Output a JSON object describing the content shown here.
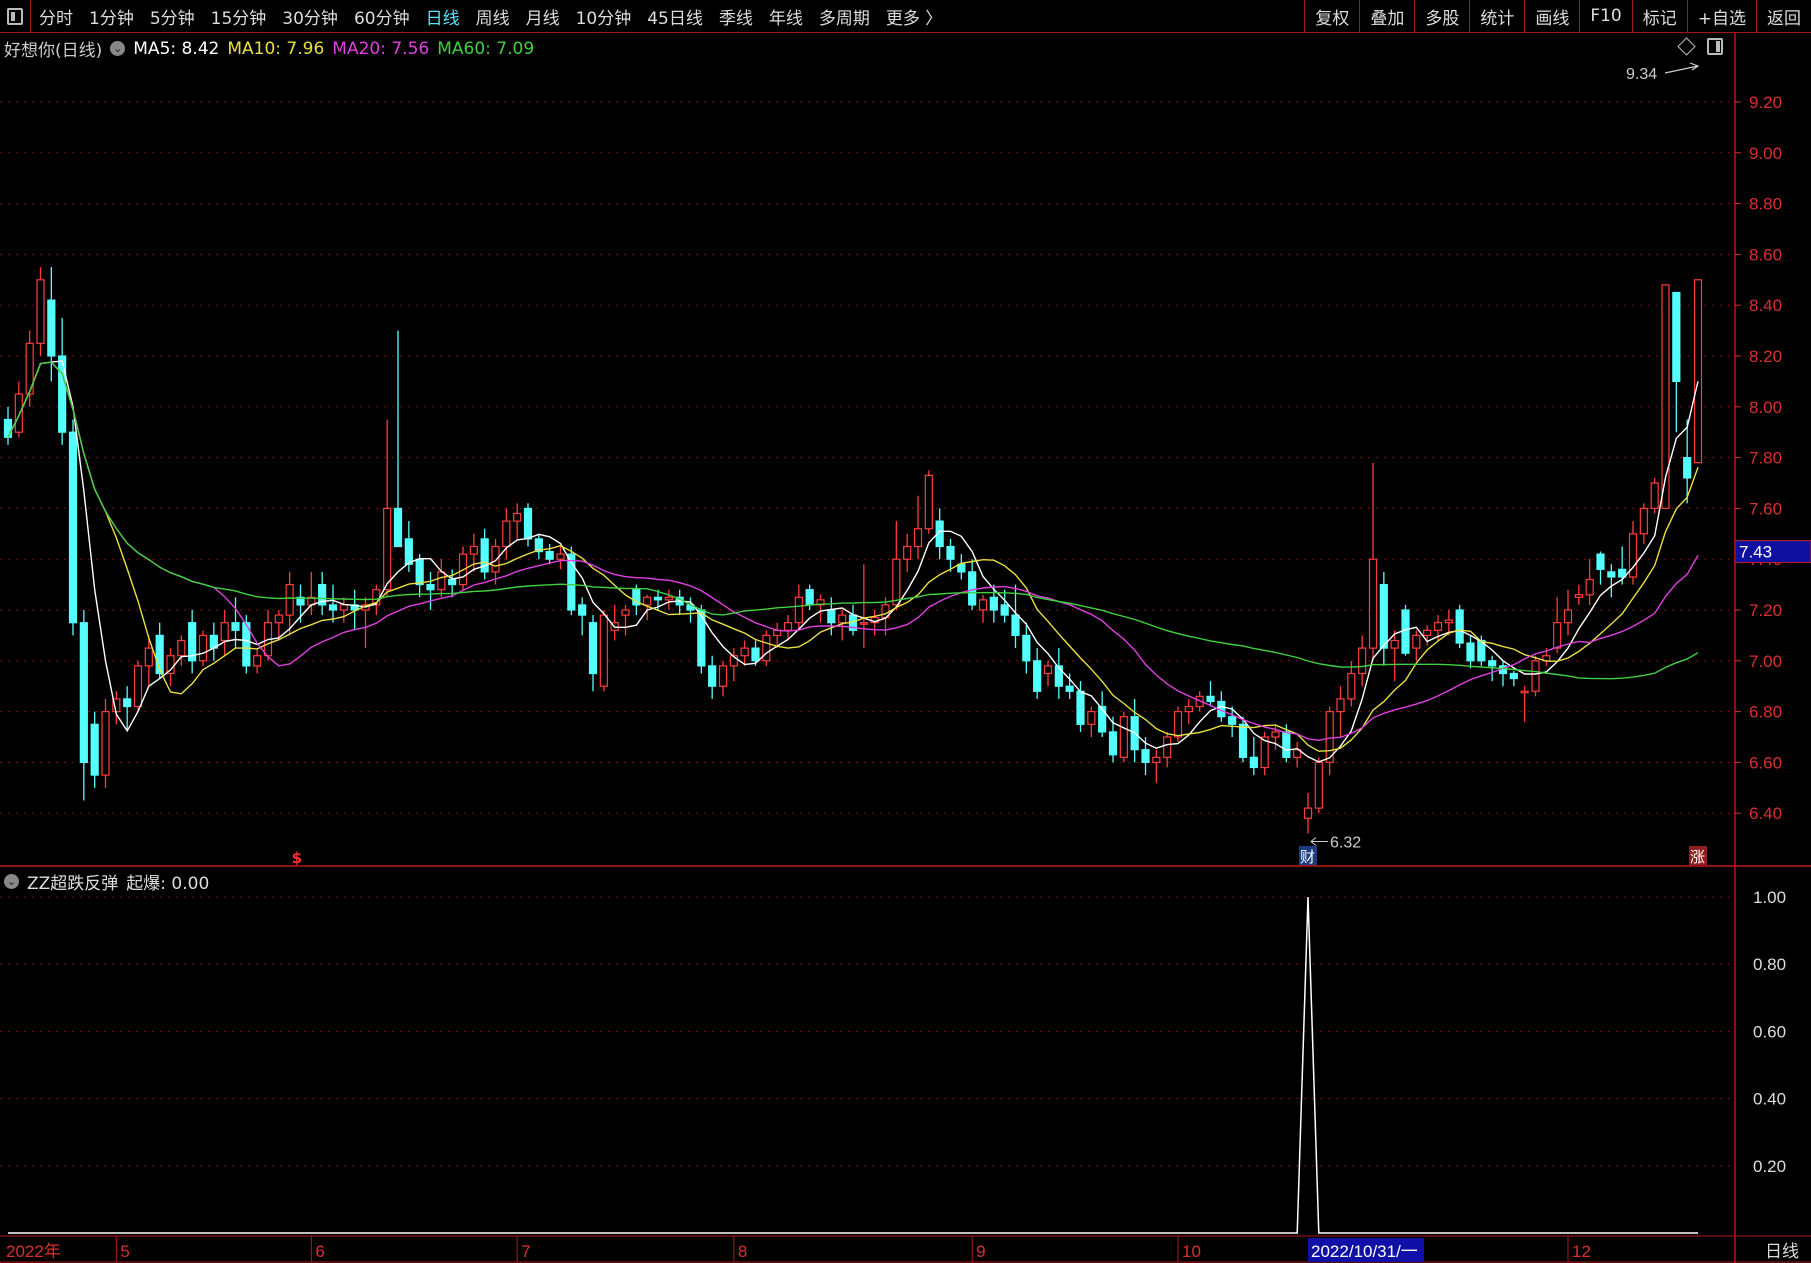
{
  "toolbar": {
    "periods": [
      "分时",
      "1分钟",
      "5分钟",
      "15分钟",
      "30分钟",
      "60分钟",
      "日线",
      "周线",
      "月线",
      "10分钟",
      "45日线",
      "季线",
      "年线",
      "多周期",
      "更多 〉"
    ],
    "active_period": "日线",
    "right_buttons": [
      "复权",
      "叠加",
      "多股",
      "统计",
      "画线",
      "F10",
      "标记",
      "+自选",
      "返回"
    ]
  },
  "legend": {
    "title": "好想你(日线)",
    "ma5": "MA5: 8.42",
    "ma10": "MA10: 7.96",
    "ma20": "MA20: 7.56",
    "ma60": "MA60: 7.09"
  },
  "indicator": {
    "name": "ZZ超跌反弹",
    "value_label": "起爆: 0.00",
    "axis_labels": [
      "1.00",
      "0.80",
      "0.60",
      "0.40",
      "0.20"
    ]
  },
  "annotations": {
    "high_label": "9.34",
    "low_label": "6.32",
    "current_price": "7.43",
    "marker_cai": "财",
    "marker_zhang": "涨",
    "marker_dollar": "$"
  },
  "axis": {
    "price_labels": [
      "9.20",
      "9.00",
      "8.80",
      "8.60",
      "8.40",
      "8.20",
      "8.00",
      "7.80",
      "7.60",
      "7.40",
      "7.20",
      "7.00",
      "6.80",
      "6.60",
      "6.40"
    ],
    "period_label": "日线"
  },
  "colors": {
    "up": "#ff3c3c",
    "down": "#54ffff",
    "ma5": "#ffffff",
    "ma10": "#e8e040",
    "ma20": "#e040e0",
    "ma60": "#40d040",
    "grid": "#7a1010",
    "axis": "#d83030"
  },
  "chart_data": {
    "type": "candlestick",
    "price_range": [
      6.24,
      9.34
    ],
    "ohlc": [
      [
        7.95,
        8.0,
        7.85,
        7.88
      ],
      [
        7.9,
        8.1,
        7.88,
        8.05
      ],
      [
        8.05,
        8.3,
        8.0,
        8.25
      ],
      [
        8.25,
        8.55,
        8.2,
        8.5
      ],
      [
        8.42,
        8.55,
        8.1,
        8.2
      ],
      [
        8.2,
        8.35,
        7.85,
        7.9
      ],
      [
        7.9,
        7.95,
        7.1,
        7.15
      ],
      [
        7.15,
        7.2,
        6.45,
        6.6
      ],
      [
        6.75,
        6.8,
        6.5,
        6.55
      ],
      [
        6.55,
        6.85,
        6.5,
        6.8
      ],
      [
        6.8,
        6.88,
        6.75,
        6.85
      ],
      [
        6.85,
        6.9,
        6.73,
        6.82
      ],
      [
        6.82,
        7.0,
        6.8,
        6.98
      ],
      [
        6.98,
        7.1,
        6.9,
        7.05
      ],
      [
        7.1,
        7.15,
        6.93,
        6.95
      ],
      [
        6.95,
        7.05,
        6.9,
        7.02
      ],
      [
        7.02,
        7.1,
        6.98,
        7.08
      ],
      [
        7.15,
        7.2,
        6.95,
        7.0
      ],
      [
        7.0,
        7.12,
        6.98,
        7.1
      ],
      [
        7.1,
        7.15,
        7.0,
        7.05
      ],
      [
        7.08,
        7.2,
        7.02,
        7.15
      ],
      [
        7.15,
        7.25,
        7.05,
        7.12
      ],
      [
        7.15,
        7.18,
        6.95,
        6.98
      ],
      [
        6.98,
        7.05,
        6.95,
        7.02
      ],
      [
        7.02,
        7.2,
        7.0,
        7.15
      ],
      [
        7.15,
        7.2,
        7.08,
        7.18
      ],
      [
        7.18,
        7.35,
        7.1,
        7.3
      ],
      [
        7.25,
        7.3,
        7.15,
        7.22
      ],
      [
        7.22,
        7.35,
        7.18,
        7.25
      ],
      [
        7.3,
        7.35,
        7.18,
        7.22
      ],
      [
        7.22,
        7.3,
        7.15,
        7.2
      ],
      [
        7.2,
        7.25,
        7.15,
        7.22
      ],
      [
        7.22,
        7.28,
        7.12,
        7.2
      ],
      [
        7.2,
        7.25,
        7.05,
        7.22
      ],
      [
        7.22,
        7.3,
        7.18,
        7.28
      ],
      [
        7.28,
        7.95,
        7.25,
        7.6
      ],
      [
        7.6,
        8.3,
        7.45,
        7.45
      ],
      [
        7.48,
        7.55,
        7.35,
        7.38
      ],
      [
        7.4,
        7.42,
        7.25,
        7.3
      ],
      [
        7.3,
        7.35,
        7.2,
        7.28
      ],
      [
        7.28,
        7.4,
        7.25,
        7.35
      ],
      [
        7.32,
        7.36,
        7.25,
        7.3
      ],
      [
        7.3,
        7.45,
        7.28,
        7.42
      ],
      [
        7.42,
        7.5,
        7.35,
        7.45
      ],
      [
        7.48,
        7.52,
        7.32,
        7.35
      ],
      [
        7.35,
        7.48,
        7.3,
        7.45
      ],
      [
        7.45,
        7.6,
        7.4,
        7.55
      ],
      [
        7.55,
        7.62,
        7.48,
        7.58
      ],
      [
        7.6,
        7.62,
        7.45,
        7.48
      ],
      [
        7.48,
        7.5,
        7.4,
        7.43
      ],
      [
        7.43,
        7.46,
        7.38,
        7.4
      ],
      [
        7.4,
        7.45,
        7.36,
        7.42
      ],
      [
        7.42,
        7.45,
        7.18,
        7.2
      ],
      [
        7.22,
        7.25,
        7.1,
        7.18
      ],
      [
        7.15,
        7.18,
        6.88,
        6.95
      ],
      [
        6.9,
        7.2,
        6.88,
        7.18
      ],
      [
        7.12,
        7.22,
        7.08,
        7.15
      ],
      [
        7.18,
        7.22,
        7.1,
        7.2
      ],
      [
        7.28,
        7.3,
        7.18,
        7.22
      ],
      [
        7.22,
        7.26,
        7.16,
        7.25
      ],
      [
        7.25,
        7.28,
        7.2,
        7.24
      ],
      [
        7.24,
        7.28,
        7.2,
        7.25
      ],
      [
        7.25,
        7.28,
        7.18,
        7.22
      ],
      [
        7.22,
        7.25,
        7.15,
        7.2
      ],
      [
        7.2,
        7.22,
        6.95,
        6.98
      ],
      [
        6.98,
        7.02,
        6.85,
        6.9
      ],
      [
        6.9,
        7.0,
        6.86,
        6.98
      ],
      [
        6.98,
        7.05,
        6.92,
        7.02
      ],
      [
        7.02,
        7.08,
        6.98,
        7.05
      ],
      [
        7.05,
        7.08,
        6.98,
        7.0
      ],
      [
        7.0,
        7.12,
        6.98,
        7.1
      ],
      [
        7.1,
        7.15,
        7.05,
        7.12
      ],
      [
        7.12,
        7.18,
        7.08,
        7.15
      ],
      [
        7.15,
        7.3,
        7.12,
        7.25
      ],
      [
        7.28,
        7.3,
        7.2,
        7.22
      ],
      [
        7.22,
        7.26,
        7.15,
        7.24
      ],
      [
        7.2,
        7.25,
        7.1,
        7.15
      ],
      [
        7.15,
        7.2,
        7.08,
        7.18
      ],
      [
        7.18,
        7.22,
        7.1,
        7.12
      ],
      [
        7.15,
        7.38,
        7.05,
        7.15
      ],
      [
        7.15,
        7.2,
        7.1,
        7.17
      ],
      [
        7.17,
        7.25,
        7.1,
        7.22
      ],
      [
        7.22,
        7.55,
        7.2,
        7.4
      ],
      [
        7.4,
        7.5,
        7.35,
        7.45
      ],
      [
        7.45,
        7.65,
        7.4,
        7.52
      ],
      [
        7.52,
        7.75,
        7.5,
        7.73
      ],
      [
        7.55,
        7.6,
        7.4,
        7.45
      ],
      [
        7.45,
        7.48,
        7.35,
        7.4
      ],
      [
        7.38,
        7.42,
        7.32,
        7.35
      ],
      [
        7.35,
        7.4,
        7.2,
        7.22
      ],
      [
        7.2,
        7.26,
        7.15,
        7.24
      ],
      [
        7.25,
        7.3,
        7.15,
        7.2
      ],
      [
        7.22,
        7.28,
        7.15,
        7.18
      ],
      [
        7.18,
        7.3,
        7.05,
        7.1
      ],
      [
        7.1,
        7.15,
        6.95,
        7.0
      ],
      [
        7.0,
        7.05,
        6.85,
        6.88
      ],
      [
        6.95,
        7.0,
        6.9,
        6.98
      ],
      [
        6.98,
        7.05,
        6.85,
        6.9
      ],
      [
        6.9,
        6.95,
        6.85,
        6.88
      ],
      [
        6.88,
        6.92,
        6.72,
        6.75
      ],
      [
        6.75,
        6.82,
        6.7,
        6.8
      ],
      [
        6.82,
        6.88,
        6.7,
        6.72
      ],
      [
        6.72,
        6.78,
        6.6,
        6.63
      ],
      [
        6.62,
        6.8,
        6.6,
        6.78
      ],
      [
        6.78,
        6.85,
        6.6,
        6.65
      ],
      [
        6.65,
        6.7,
        6.55,
        6.6
      ],
      [
        6.6,
        6.65,
        6.52,
        6.62
      ],
      [
        6.62,
        6.72,
        6.58,
        6.7
      ],
      [
        6.7,
        6.82,
        6.68,
        6.8
      ],
      [
        6.8,
        6.85,
        6.75,
        6.82
      ],
      [
        6.82,
        6.88,
        6.8,
        6.86
      ],
      [
        6.86,
        6.92,
        6.82,
        6.84
      ],
      [
        6.84,
        6.88,
        6.76,
        6.78
      ],
      [
        6.78,
        6.82,
        6.7,
        6.75
      ],
      [
        6.75,
        6.78,
        6.6,
        6.62
      ],
      [
        6.62,
        6.7,
        6.55,
        6.58
      ],
      [
        6.58,
        6.72,
        6.55,
        6.7
      ],
      [
        6.7,
        6.75,
        6.65,
        6.72
      ],
      [
        6.72,
        6.75,
        6.6,
        6.62
      ],
      [
        6.62,
        6.68,
        6.58,
        6.65
      ],
      [
        6.38,
        6.48,
        6.32,
        6.42
      ],
      [
        6.42,
        6.62,
        6.4,
        6.6
      ],
      [
        6.6,
        6.82,
        6.55,
        6.8
      ],
      [
        6.8,
        6.9,
        6.7,
        6.85
      ],
      [
        6.85,
        7.0,
        6.82,
        6.95
      ],
      [
        6.95,
        7.1,
        6.9,
        7.05
      ],
      [
        7.05,
        7.78,
        7.0,
        7.4
      ],
      [
        7.3,
        7.35,
        6.98,
        7.05
      ],
      [
        7.05,
        7.12,
        6.92,
        7.08
      ],
      [
        7.2,
        7.22,
        7.02,
        7.03
      ],
      [
        7.05,
        7.12,
        7.0,
        7.1
      ],
      [
        7.1,
        7.14,
        7.06,
        7.12
      ],
      [
        7.12,
        7.18,
        7.08,
        7.15
      ],
      [
        7.15,
        7.2,
        7.1,
        7.16
      ],
      [
        7.2,
        7.22,
        7.05,
        7.07
      ],
      [
        7.07,
        7.1,
        6.97,
        7.0
      ],
      [
        7.08,
        7.1,
        6.98,
        7.0
      ],
      [
        7.0,
        7.02,
        6.92,
        6.98
      ],
      [
        6.98,
        7.0,
        6.9,
        6.95
      ],
      [
        6.95,
        6.96,
        6.9,
        6.93
      ],
      [
        6.88,
        6.9,
        6.76,
        6.88
      ],
      [
        6.88,
        7.02,
        6.86,
        7.0
      ],
      [
        7.0,
        7.05,
        6.98,
        7.02
      ],
      [
        7.05,
        7.25,
        7.03,
        7.15
      ],
      [
        7.15,
        7.28,
        7.1,
        7.2
      ],
      [
        7.25,
        7.3,
        7.22,
        7.26
      ],
      [
        7.26,
        7.4,
        7.22,
        7.32
      ],
      [
        7.42,
        7.43,
        7.3,
        7.36
      ],
      [
        7.35,
        7.38,
        7.25,
        7.33
      ],
      [
        7.36,
        7.45,
        7.3,
        7.33
      ],
      [
        7.33,
        7.55,
        7.3,
        7.5
      ],
      [
        7.5,
        7.62,
        7.46,
        7.6
      ],
      [
        7.6,
        7.72,
        7.58,
        7.7
      ],
      [
        7.6,
        8.48,
        7.6,
        8.48
      ],
      [
        8.45,
        8.45,
        7.9,
        8.1
      ],
      [
        7.8,
        7.95,
        7.62,
        7.72
      ],
      [
        7.78,
        8.5,
        7.78,
        8.5
      ]
    ],
    "ma_periods": [
      5,
      10,
      20,
      60
    ],
    "indicator_signal_index": 120,
    "indicator_range": [
      0,
      1
    ],
    "marker_indices": {
      "cai": 120,
      "zhang": 156,
      "dollar": 26,
      "high": 156,
      "low": 120
    },
    "date_labels": [
      {
        "index": 0,
        "text": "2022年"
      },
      {
        "index": 10,
        "text": "5"
      },
      {
        "index": 28,
        "text": "6"
      },
      {
        "index": 47,
        "text": "7"
      },
      {
        "index": 67,
        "text": "8"
      },
      {
        "index": 89,
        "text": "9"
      },
      {
        "index": 108,
        "text": "10"
      },
      {
        "index": 144,
        "text": "12"
      }
    ],
    "cursor_date": {
      "index": 120,
      "text": "2022/10/31/一"
    }
  }
}
